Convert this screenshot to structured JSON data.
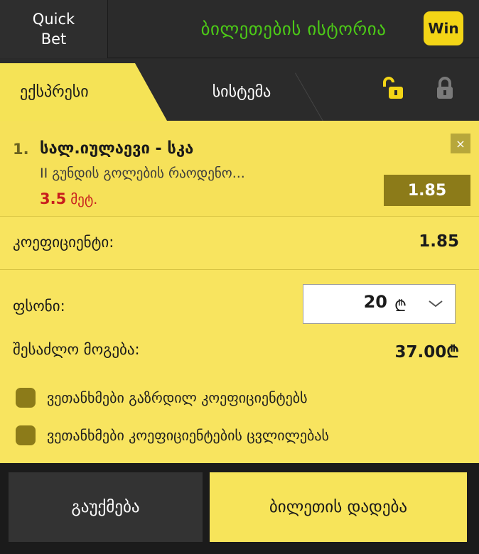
{
  "header": {
    "quick_bet_line1": "Quick",
    "quick_bet_line2": "Bet",
    "history_title": "ბილეთების ისტორია",
    "win_badge": "Win"
  },
  "tabs": {
    "express": "ექსპრესი",
    "system": "სისტემა"
  },
  "bet": {
    "number": "1.",
    "match": "სალ.იულაევი - სკა",
    "market": "II გუნდის გოლების რაოდენო...",
    "pick_value": "3.5",
    "pick_label": " მეტ.",
    "odds": "1.85",
    "remove_label": "×"
  },
  "summary": {
    "coef_label": "კოეფიციენტი:",
    "coef_value": "1.85",
    "stake_label": "ფსონი:",
    "stake_value": "20",
    "currency": "₾",
    "win_label": "შესაძლო მოგება:",
    "win_value": "37.00₾"
  },
  "options": {
    "accept_increased": "ვეთანხმები გაზრდილ კოეფიციენტებს",
    "accept_changes": "ვეთანხმები კოეფიციენტების ცვლილებას"
  },
  "actions": {
    "cancel": "გაუქმება",
    "place_bet": "ბილეთის დადება"
  },
  "colors": {
    "accent_yellow": "#f5e356",
    "odds_olive": "#8c7b19",
    "history_green": "#4cc917",
    "pick_red": "#c81d1d"
  }
}
